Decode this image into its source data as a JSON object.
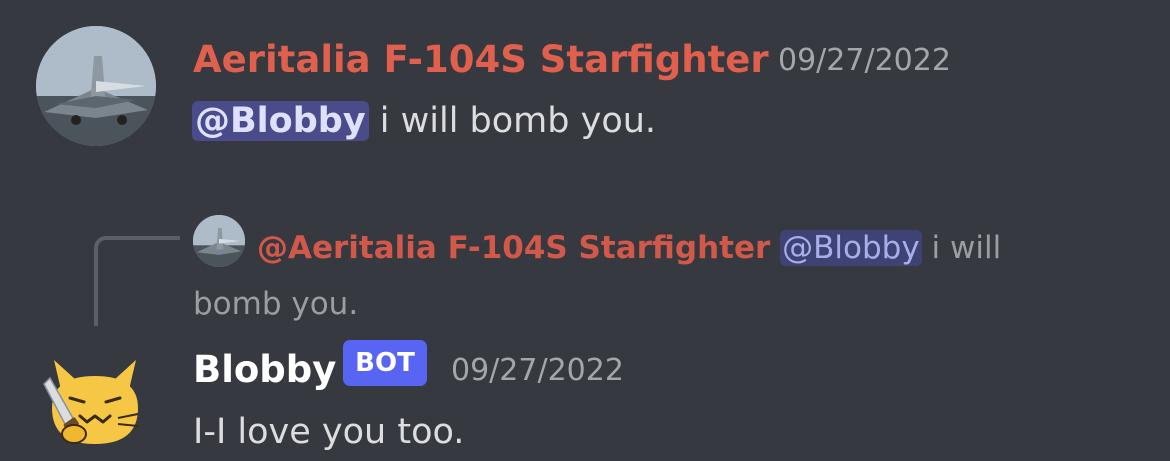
{
  "messages": [
    {
      "author": "Aeritalia F-104S Starfighter",
      "author_color": "#e05f4d",
      "timestamp": "09/27/2022",
      "avatar": "f104-starfighter-avatar",
      "mention": "@Blobby",
      "text": " i will bomb you."
    },
    {
      "reply": {
        "author": "@Aeritalia F-104S Starfighter",
        "mention": "@Blobby",
        "text": " i will bomb you."
      },
      "author": "Blobby",
      "bot_tag": "BOT",
      "bot_tag_color": "#5865f2",
      "timestamp": "09/27/2022",
      "avatar": "cat-emoji-avatar",
      "text": "I-I love you too."
    }
  ]
}
